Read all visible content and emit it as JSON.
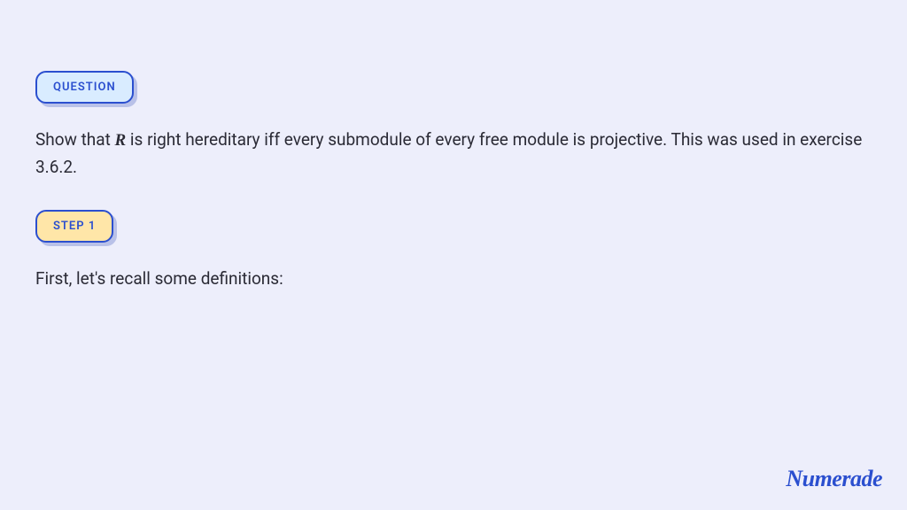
{
  "badges": {
    "question": "QUESTION",
    "step1": "STEP 1"
  },
  "question": {
    "prefix": "Show that ",
    "var": "R",
    "suffix": " is right hereditary iff every submodule of every free module is projective. This was used in exercise 3.6.2."
  },
  "step1_text": "First, let's recall some definitions:",
  "brand": "Numerade"
}
